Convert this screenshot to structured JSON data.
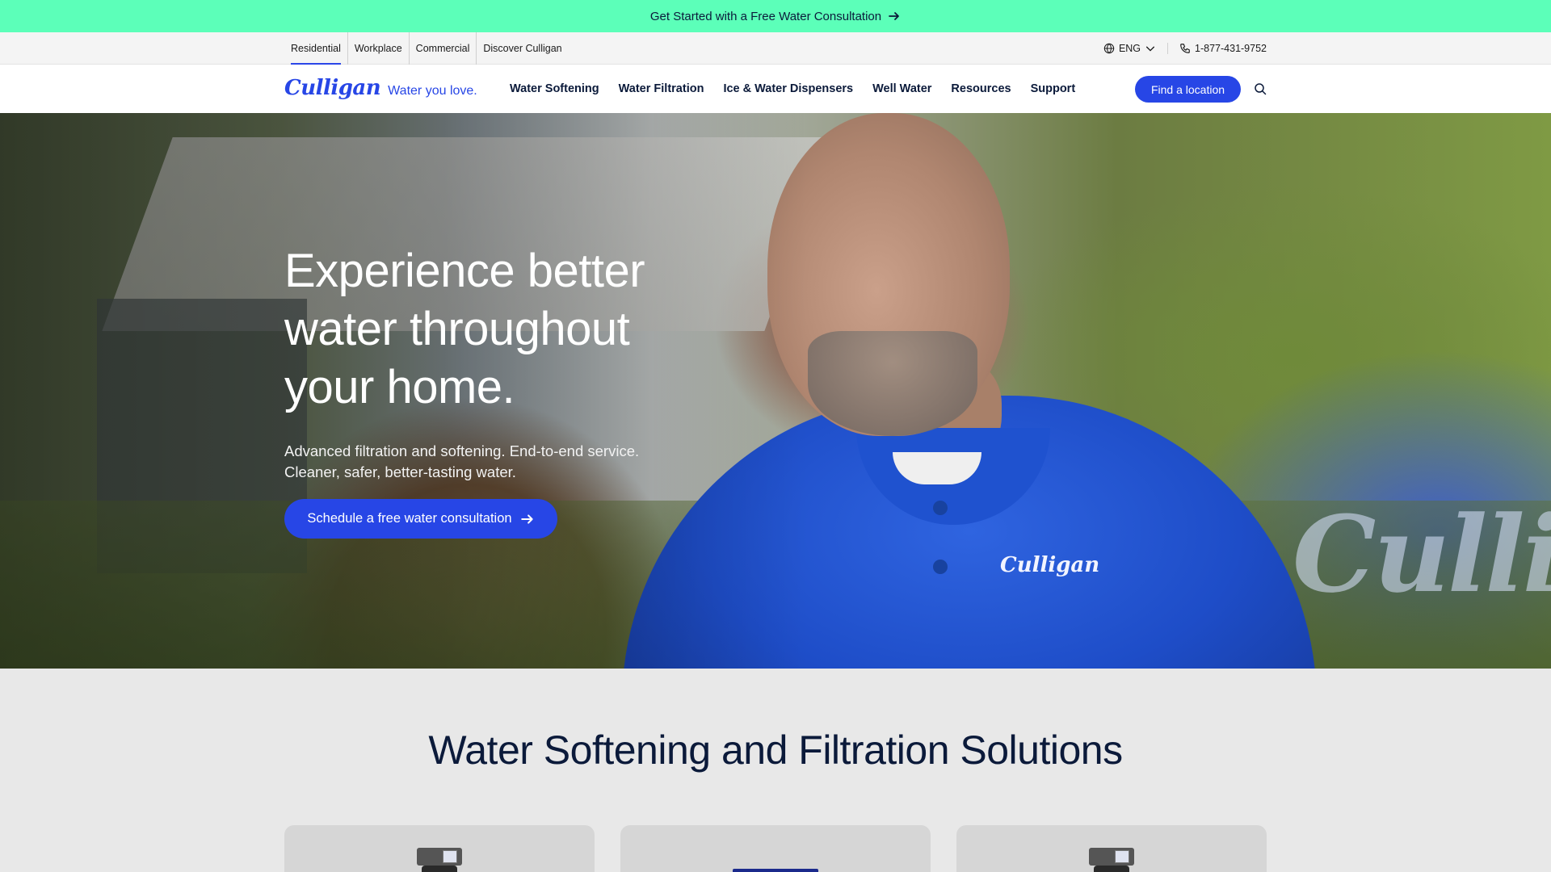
{
  "promo": {
    "text": "Get Started with a Free Water Consultation",
    "icon": "arrow-right-icon"
  },
  "utility": {
    "segments": [
      "Residential",
      "Workplace",
      "Commercial",
      "Discover Culligan"
    ],
    "active_segment": "Residential",
    "language": "ENG",
    "phone": "1-877-431-9752"
  },
  "nav": {
    "brand": "Culligan",
    "tagline": "Water you love.",
    "menu": [
      "Water Softening",
      "Water Filtration",
      "Ice & Water Dispensers",
      "Well Water",
      "Resources",
      "Support"
    ],
    "cta": "Find a location"
  },
  "hero": {
    "headline_lines": [
      "Experience better",
      "water throughout",
      "your home."
    ],
    "sub_lines": [
      "Advanced filtration and softening. End-to-end service.",
      "Cleaner, safer, better-tasting water."
    ],
    "cta": "Schedule a free water consultation",
    "shirt_logo": "Culligan"
  },
  "solutions": {
    "title": "Water Softening and Filtration Solutions"
  },
  "colors": {
    "brand_blue": "#2746e6",
    "promo_green": "#5cffb9",
    "navy_text": "#0b1a3a"
  }
}
